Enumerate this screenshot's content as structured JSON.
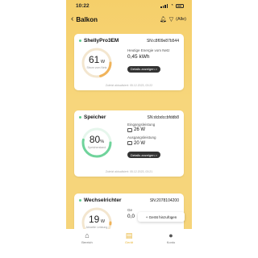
{
  "status_bar": {
    "time": "10:22"
  },
  "header": {
    "title": "Balkon",
    "filter_label": "(Alle)"
  },
  "cards": [
    {
      "name": "ShellyPro3EM",
      "sn": "SN:c8f09e87b544",
      "gauge_value": "61",
      "gauge_unit": "W",
      "gauge_sub": "Strom vom Netz",
      "label": "Heutige Energie vom Netz",
      "value": "0,45 kWh",
      "button": "Details anzeigen >",
      "updated": "Zuletzt aktualisiert: 05.12.2023, 03:22"
    },
    {
      "name": "Speicher",
      "sn": "SN:dcbdccbfddb8",
      "gauge_value": "80",
      "gauge_unit": "%",
      "gauge_sub": "Speicherstand",
      "label_in": "Eingangsleistung",
      "value_in": "26 W",
      "label_out": "Ausgangsleistung",
      "value_out": "20 W",
      "button": "Details anzeigen >",
      "updated": "Zuletzt aktualisiert: 05.12.2023, 03:21"
    },
    {
      "name": "Wechselrichter",
      "sn": "SN:2078104200",
      "gauge_value": "19",
      "gauge_unit": "W",
      "gauge_sub": "Aktuelle Leistung",
      "label_partial": "Ge",
      "value_partial": "0,0"
    }
  ],
  "toast": "+ Gerät hinzufügen",
  "tabs": [
    {
      "label": "Bereich",
      "icon": "home-icon"
    },
    {
      "label": "Gerät",
      "icon": "device-icon"
    },
    {
      "label": "Konto",
      "icon": "person-icon"
    }
  ],
  "colors": {
    "accent": "#f5cf6a",
    "gauge_orange": "#f0b35a",
    "gauge_green": "#6fd39b",
    "active_tab": "#e9b73c"
  }
}
